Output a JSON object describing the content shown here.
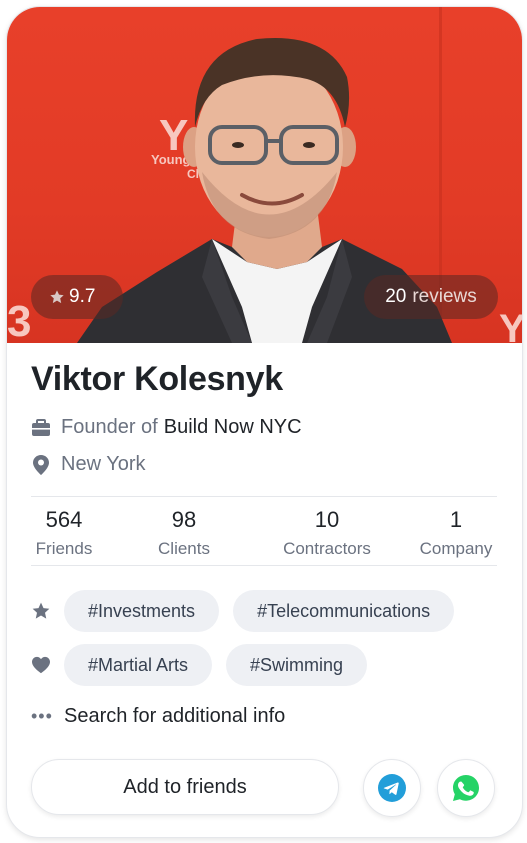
{
  "profile": {
    "name": "Viktor Kolesnyk",
    "rating": "9.7",
    "reviews_count": "20",
    "reviews_label": "reviews",
    "job_prefix": "Founder of",
    "company": "Build Now NYC",
    "location": "New York"
  },
  "stats": [
    {
      "value": "564",
      "label": "Friends"
    },
    {
      "value": "98",
      "label": "Clients"
    },
    {
      "value": "10",
      "label": "Contractors"
    },
    {
      "value": "1",
      "label": "Company"
    }
  ],
  "interests": {
    "professional": [
      "#Investments",
      "#Telecommunications"
    ],
    "personal": [
      "#Martial Arts",
      "#Swimming"
    ],
    "more_label": "Search for additional info"
  },
  "actions": {
    "add_friend_label": "Add to friends",
    "telegram_icon": "telegram-icon",
    "whatsapp_icon": "whatsapp-icon"
  },
  "photo_backdrop_text": {
    "logo_big": "Y",
    "logo_small": "Young",
    "logo_tail": "Cl",
    "edge_left": "3",
    "edge_right": "Y"
  },
  "colors": {
    "backdrop": "#e23b26",
    "telegram": "#229ed9",
    "whatsapp": "#25d366",
    "text_primary": "#1f2328",
    "text_secondary": "#6b7280"
  }
}
